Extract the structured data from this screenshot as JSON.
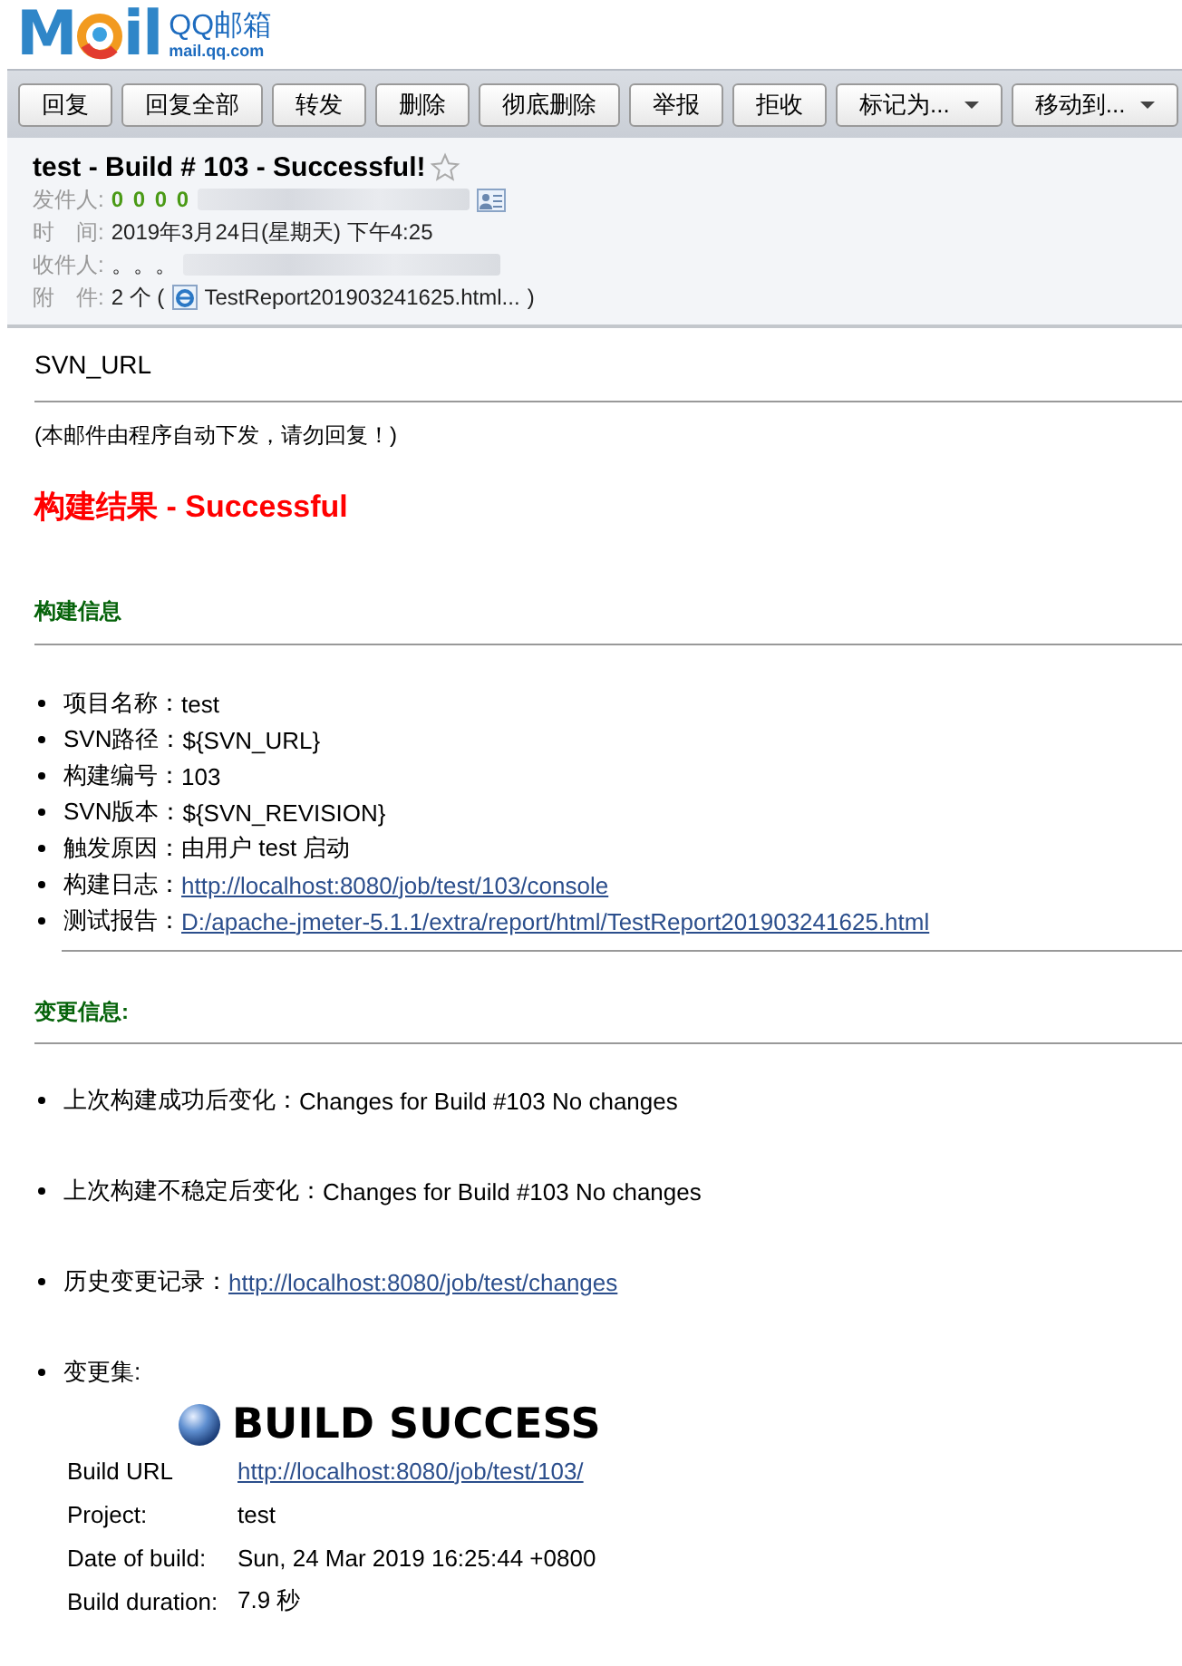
{
  "logo": {
    "mark_left": "M",
    "mark_right": "il",
    "product": "QQ邮箱",
    "domain": "mail.qq.com"
  },
  "toolbar": [
    {
      "label": "回复",
      "has_menu": false
    },
    {
      "label": "回复全部",
      "has_menu": false
    },
    {
      "label": "转发",
      "has_menu": false
    },
    {
      "label": "删除",
      "has_menu": false
    },
    {
      "label": "彻底删除",
      "has_menu": false
    },
    {
      "label": "举报",
      "has_menu": false
    },
    {
      "label": "拒收",
      "has_menu": false
    },
    {
      "label": "标记为...",
      "has_menu": true
    },
    {
      "label": "移动到...",
      "has_menu": true
    }
  ],
  "message": {
    "subject": "test - Build # 103 - Successful!",
    "starred": false,
    "from": {
      "label": "发件人:",
      "name": "0 0 0 0"
    },
    "time": {
      "label": "时　间:",
      "value": "2019年3月24日(星期天) 下午4:25"
    },
    "to": {
      "label": "收件人:",
      "value": "。。。"
    },
    "attachments": {
      "label": "附　件:",
      "count": "2 个 (",
      "file": "TestReport201903241625.html...",
      "close": ")"
    }
  },
  "body": {
    "svn_url": "SVN_URL",
    "notice": "(本邮件由程序自动下发，请勿回复！)",
    "result_heading": "构建结果 - Successful",
    "build_info": {
      "title": "构建信息",
      "items": [
        {
          "label": "项目名称：",
          "value": "test",
          "kind": "text"
        },
        {
          "label": "SVN路径：",
          "value": "${SVN_URL}",
          "kind": "text"
        },
        {
          "label": "构建编号：",
          "value": "103",
          "kind": "text"
        },
        {
          "label": "SVN版本：",
          "value": "${SVN_REVISION}",
          "kind": "text"
        },
        {
          "label": "触发原因：",
          "value": "由用户 test 启动",
          "kind": "text"
        },
        {
          "label": "构建日志：",
          "value": "http://localhost:8080/job/test/103/console",
          "kind": "link"
        },
        {
          "label": "测试报告：",
          "value": "D:/apache-jmeter-5.1.1/extra/report/html/TestReport201903241625.html",
          "kind": "link"
        }
      ]
    },
    "changes": {
      "title": "变更信息:",
      "items": [
        {
          "label": "上次构建成功后变化：",
          "value": "Changes for Build #103 No changes",
          "kind": "text"
        },
        {
          "label": "上次构建不稳定后变化：",
          "value": "Changes for Build #103 No changes",
          "kind": "text"
        },
        {
          "label": "历史变更记录：",
          "value": "http://localhost:8080/job/test/changes",
          "kind": "link"
        },
        {
          "label": "变更集:",
          "kind": "changeset"
        }
      ]
    },
    "changeset": {
      "status": "BUILD SUCCESS",
      "rows": [
        {
          "label": "Build URL",
          "value": "http://localhost:8080/job/test/103/",
          "kind": "link"
        },
        {
          "label": "Project:",
          "value": "test",
          "kind": "text"
        },
        {
          "label": "Date of build:",
          "value": "Sun, 24 Mar 2019 16:25:44 +0800",
          "kind": "text"
        },
        {
          "label": "Build duration:",
          "value": "7.9 秒",
          "kind": "text"
        }
      ]
    }
  }
}
